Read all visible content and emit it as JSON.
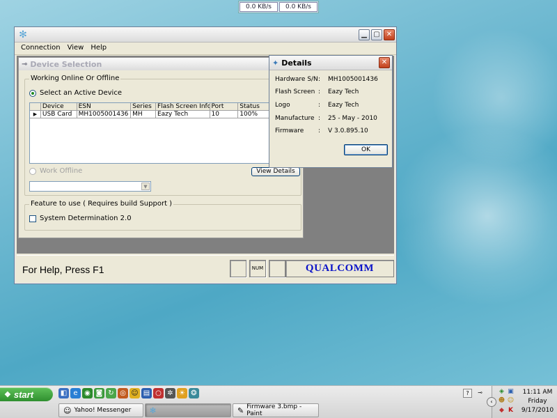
{
  "netmeter": {
    "down": "0.0 KB/s",
    "up": "0.0 KB/s"
  },
  "app": {
    "menu": [
      "Connection",
      "View",
      "Help"
    ],
    "panel_title": "Device Selection",
    "group_online": "Working Online Or Offline",
    "radio_active": "Select an Active Device",
    "grid": {
      "headers": [
        "Device",
        "ESN",
        "Series",
        "Flash Screen Info",
        "Port",
        "Status"
      ],
      "rows": [
        [
          "USB Card",
          "MH1005001436",
          "MH",
          "Eazy Tech",
          "10",
          "100%"
        ]
      ]
    },
    "radio_offline": "Work Offline",
    "view_details": "View Details",
    "group_feature": "Feature to use ( Requires build Support )",
    "feature_checkbox": "System Determination 2.0",
    "help_text": "For Help, Press F1",
    "num_indicator": "NUM",
    "brand": "QUALCOMM"
  },
  "details": {
    "title": "Details",
    "rows": [
      {
        "k": "Hardware S/N",
        "v": "MH1005001436"
      },
      {
        "k": "Flash Screen",
        "v": "Eazy Tech"
      },
      {
        "k": "Logo",
        "v": "Eazy Tech"
      },
      {
        "k": "Manufacture",
        "v": "25 - May - 2010"
      },
      {
        "k": "Firmware",
        "v": "V 3.0.895.10"
      }
    ],
    "ok": "OK"
  },
  "taskbar": {
    "start": "start",
    "tasks": [
      {
        "label": "Yahoo! Messenger",
        "icon": "smiley-icon"
      },
      {
        "label": "",
        "icon": "app-icon"
      },
      {
        "label": "Firmware 3.bmp - Paint",
        "icon": "paint-icon"
      }
    ],
    "clock_time": "11:11 AM",
    "clock_day": "Friday",
    "clock_date": "9/17/2010"
  },
  "colors": {
    "brand": "#0a12c8",
    "desktop": "#6fb9d1",
    "start": "#3a9a3a"
  }
}
